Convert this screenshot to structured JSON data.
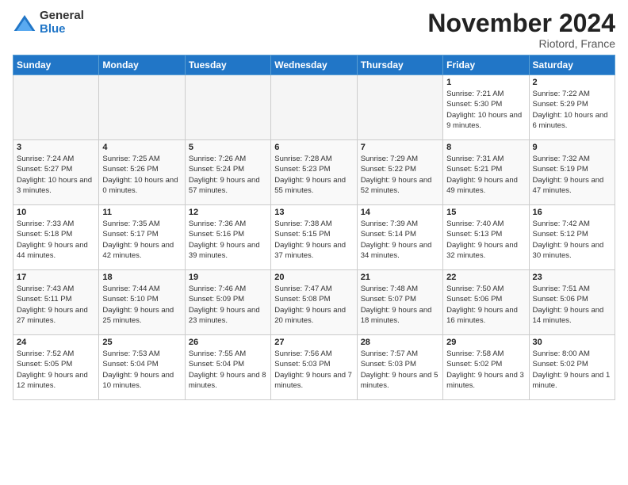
{
  "header": {
    "logo_general": "General",
    "logo_blue": "Blue",
    "month_title": "November 2024",
    "location": "Riotord, France"
  },
  "days_of_week": [
    "Sunday",
    "Monday",
    "Tuesday",
    "Wednesday",
    "Thursday",
    "Friday",
    "Saturday"
  ],
  "weeks": [
    [
      {
        "day": "",
        "empty": true
      },
      {
        "day": "",
        "empty": true
      },
      {
        "day": "",
        "empty": true
      },
      {
        "day": "",
        "empty": true
      },
      {
        "day": "",
        "empty": true
      },
      {
        "day": "1",
        "sunrise": "Sunrise: 7:21 AM",
        "sunset": "Sunset: 5:30 PM",
        "daylight": "Daylight: 10 hours and 9 minutes."
      },
      {
        "day": "2",
        "sunrise": "Sunrise: 7:22 AM",
        "sunset": "Sunset: 5:29 PM",
        "daylight": "Daylight: 10 hours and 6 minutes."
      }
    ],
    [
      {
        "day": "3",
        "sunrise": "Sunrise: 7:24 AM",
        "sunset": "Sunset: 5:27 PM",
        "daylight": "Daylight: 10 hours and 3 minutes."
      },
      {
        "day": "4",
        "sunrise": "Sunrise: 7:25 AM",
        "sunset": "Sunset: 5:26 PM",
        "daylight": "Daylight: 10 hours and 0 minutes."
      },
      {
        "day": "5",
        "sunrise": "Sunrise: 7:26 AM",
        "sunset": "Sunset: 5:24 PM",
        "daylight": "Daylight: 9 hours and 57 minutes."
      },
      {
        "day": "6",
        "sunrise": "Sunrise: 7:28 AM",
        "sunset": "Sunset: 5:23 PM",
        "daylight": "Daylight: 9 hours and 55 minutes."
      },
      {
        "day": "7",
        "sunrise": "Sunrise: 7:29 AM",
        "sunset": "Sunset: 5:22 PM",
        "daylight": "Daylight: 9 hours and 52 minutes."
      },
      {
        "day": "8",
        "sunrise": "Sunrise: 7:31 AM",
        "sunset": "Sunset: 5:21 PM",
        "daylight": "Daylight: 9 hours and 49 minutes."
      },
      {
        "day": "9",
        "sunrise": "Sunrise: 7:32 AM",
        "sunset": "Sunset: 5:19 PM",
        "daylight": "Daylight: 9 hours and 47 minutes."
      }
    ],
    [
      {
        "day": "10",
        "sunrise": "Sunrise: 7:33 AM",
        "sunset": "Sunset: 5:18 PM",
        "daylight": "Daylight: 9 hours and 44 minutes."
      },
      {
        "day": "11",
        "sunrise": "Sunrise: 7:35 AM",
        "sunset": "Sunset: 5:17 PM",
        "daylight": "Daylight: 9 hours and 42 minutes."
      },
      {
        "day": "12",
        "sunrise": "Sunrise: 7:36 AM",
        "sunset": "Sunset: 5:16 PM",
        "daylight": "Daylight: 9 hours and 39 minutes."
      },
      {
        "day": "13",
        "sunrise": "Sunrise: 7:38 AM",
        "sunset": "Sunset: 5:15 PM",
        "daylight": "Daylight: 9 hours and 37 minutes."
      },
      {
        "day": "14",
        "sunrise": "Sunrise: 7:39 AM",
        "sunset": "Sunset: 5:14 PM",
        "daylight": "Daylight: 9 hours and 34 minutes."
      },
      {
        "day": "15",
        "sunrise": "Sunrise: 7:40 AM",
        "sunset": "Sunset: 5:13 PM",
        "daylight": "Daylight: 9 hours and 32 minutes."
      },
      {
        "day": "16",
        "sunrise": "Sunrise: 7:42 AM",
        "sunset": "Sunset: 5:12 PM",
        "daylight": "Daylight: 9 hours and 30 minutes."
      }
    ],
    [
      {
        "day": "17",
        "sunrise": "Sunrise: 7:43 AM",
        "sunset": "Sunset: 5:11 PM",
        "daylight": "Daylight: 9 hours and 27 minutes."
      },
      {
        "day": "18",
        "sunrise": "Sunrise: 7:44 AM",
        "sunset": "Sunset: 5:10 PM",
        "daylight": "Daylight: 9 hours and 25 minutes."
      },
      {
        "day": "19",
        "sunrise": "Sunrise: 7:46 AM",
        "sunset": "Sunset: 5:09 PM",
        "daylight": "Daylight: 9 hours and 23 minutes."
      },
      {
        "day": "20",
        "sunrise": "Sunrise: 7:47 AM",
        "sunset": "Sunset: 5:08 PM",
        "daylight": "Daylight: 9 hours and 20 minutes."
      },
      {
        "day": "21",
        "sunrise": "Sunrise: 7:48 AM",
        "sunset": "Sunset: 5:07 PM",
        "daylight": "Daylight: 9 hours and 18 minutes."
      },
      {
        "day": "22",
        "sunrise": "Sunrise: 7:50 AM",
        "sunset": "Sunset: 5:06 PM",
        "daylight": "Daylight: 9 hours and 16 minutes."
      },
      {
        "day": "23",
        "sunrise": "Sunrise: 7:51 AM",
        "sunset": "Sunset: 5:06 PM",
        "daylight": "Daylight: 9 hours and 14 minutes."
      }
    ],
    [
      {
        "day": "24",
        "sunrise": "Sunrise: 7:52 AM",
        "sunset": "Sunset: 5:05 PM",
        "daylight": "Daylight: 9 hours and 12 minutes."
      },
      {
        "day": "25",
        "sunrise": "Sunrise: 7:53 AM",
        "sunset": "Sunset: 5:04 PM",
        "daylight": "Daylight: 9 hours and 10 minutes."
      },
      {
        "day": "26",
        "sunrise": "Sunrise: 7:55 AM",
        "sunset": "Sunset: 5:04 PM",
        "daylight": "Daylight: 9 hours and 8 minutes."
      },
      {
        "day": "27",
        "sunrise": "Sunrise: 7:56 AM",
        "sunset": "Sunset: 5:03 PM",
        "daylight": "Daylight: 9 hours and 7 minutes."
      },
      {
        "day": "28",
        "sunrise": "Sunrise: 7:57 AM",
        "sunset": "Sunset: 5:03 PM",
        "daylight": "Daylight: 9 hours and 5 minutes."
      },
      {
        "day": "29",
        "sunrise": "Sunrise: 7:58 AM",
        "sunset": "Sunset: 5:02 PM",
        "daylight": "Daylight: 9 hours and 3 minutes."
      },
      {
        "day": "30",
        "sunrise": "Sunrise: 8:00 AM",
        "sunset": "Sunset: 5:02 PM",
        "daylight": "Daylight: 9 hours and 1 minute."
      }
    ]
  ]
}
